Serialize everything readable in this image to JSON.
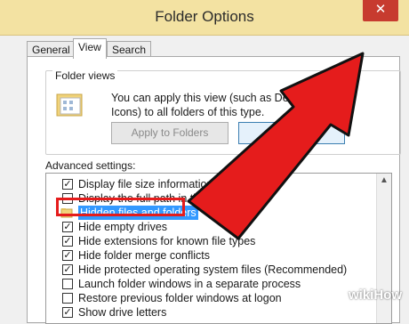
{
  "window": {
    "title": "Folder Options",
    "close_glyph": "✕"
  },
  "tabs": [
    {
      "label": "General",
      "active": false
    },
    {
      "label": "View",
      "active": true
    },
    {
      "label": "Search",
      "active": false
    }
  ],
  "folder_views": {
    "title": "Folder views",
    "description": "You can apply this view (such as Details or Icons) to all folders of this type.",
    "apply_label": "Apply to Folders",
    "reset_label": "Res"
  },
  "advanced": {
    "label": "Advanced settings:",
    "items": [
      {
        "text": "Display file size information in fo",
        "checked": true,
        "type": "checkbox"
      },
      {
        "text": "Display the full path in the title",
        "checked": false,
        "type": "checkbox"
      },
      {
        "text": "Hidden files and folders",
        "type": "folder",
        "highlighted": true
      },
      {
        "text": "Hide empty drives",
        "checked": true,
        "type": "checkbox"
      },
      {
        "text": "Hide extensions for known file types",
        "checked": true,
        "type": "checkbox"
      },
      {
        "text": "Hide folder merge conflicts",
        "checked": true,
        "type": "checkbox"
      },
      {
        "text": "Hide protected operating system files (Recommended)",
        "checked": true,
        "type": "checkbox"
      },
      {
        "text": "Launch folder windows in a separate process",
        "checked": false,
        "type": "checkbox"
      },
      {
        "text": "Restore previous folder windows at logon",
        "checked": false,
        "type": "checkbox"
      },
      {
        "text": "Show drive letters",
        "checked": true,
        "type": "checkbox"
      }
    ]
  },
  "annotation": {
    "arrow_color": "#e51c1c"
  },
  "watermark": "wikiHow",
  "colors": {
    "titlebar": "#f3e2a2",
    "close": "#c73b2f",
    "selection": "#3399ff",
    "highlight_box": "#e51c1c"
  }
}
